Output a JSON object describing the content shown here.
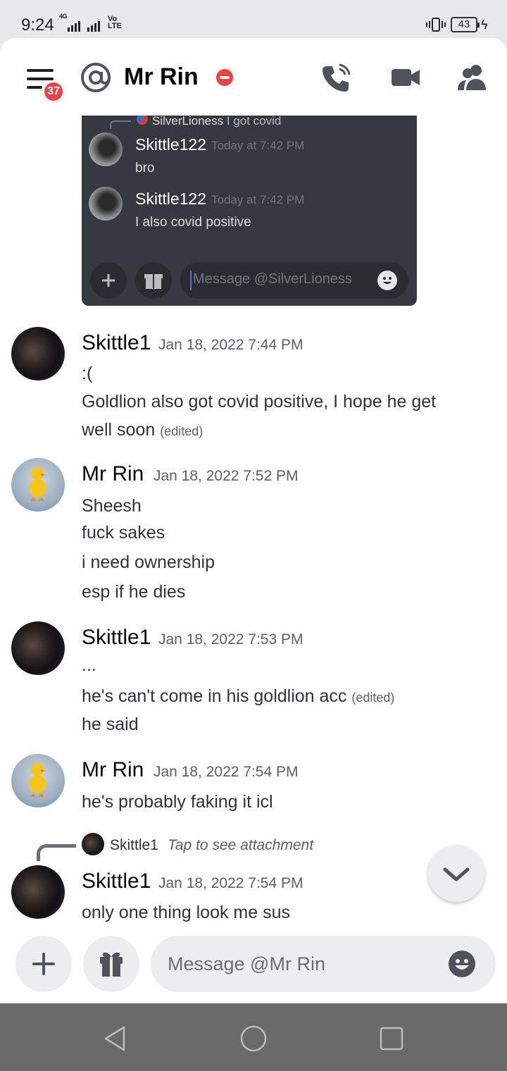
{
  "status_bar": {
    "time": "9:24",
    "network_label": "4G",
    "volte_top": "Vo",
    "volte_bottom": "LTE",
    "battery": "43"
  },
  "header": {
    "unread_badge": "37",
    "title": "Mr Rin",
    "status": "dnd",
    "icons": [
      "menu-icon",
      "at-icon",
      "dnd-icon",
      "voice-call-icon",
      "video-call-icon",
      "members-icon"
    ]
  },
  "embedded_screenshot": {
    "reply_author": "SilverLioness",
    "reply_text": "I got covid",
    "messages": [
      {
        "author": "Skittle122",
        "time": "Today at 7:42 PM",
        "text": "bro"
      },
      {
        "author": "Skittle122",
        "time": "Today at 7:42 PM",
        "text": "I also covid positive"
      }
    ],
    "input_placeholder": "Message @SilverLioness"
  },
  "messages": [
    {
      "author": "Skittle1",
      "time": "Jan 18, 2022 7:44 PM",
      "lines": [
        ":(",
        "Goldlion also got covid positive, I hope he get",
        "well soon"
      ],
      "edited_label": "(edited)"
    },
    {
      "author": "Mr Rin",
      "time": "Jan 18, 2022 7:52 PM",
      "lines": [
        "Sheesh",
        "fuck sakes",
        "i need ownership",
        "esp if he dies"
      ]
    },
    {
      "author": "Skittle1",
      "time": "Jan 18, 2022 7:53 PM",
      "lines": [
        "...",
        "he's can't come in his goldlion acc",
        "he said"
      ],
      "edited_label": "(edited)"
    },
    {
      "author": "Mr Rin",
      "time": "Jan 18, 2022 7:54 PM",
      "lines": [
        "he's probably faking it icl"
      ]
    },
    {
      "reply_author": "Skittle1",
      "reply_text": "Tap to see attachment",
      "author": "Skittle1",
      "time": "Jan 18, 2022 7:54 PM",
      "lines": [
        "only one thing look me sus"
      ]
    }
  ],
  "composer": {
    "placeholder": "Message @Mr Rin",
    "icons": [
      "plus-icon",
      "gift-icon",
      "emoji-icon"
    ]
  },
  "colors": {
    "accent": "#5865f2",
    "badge": "#ed4245",
    "embed_bg": "#36393f"
  }
}
